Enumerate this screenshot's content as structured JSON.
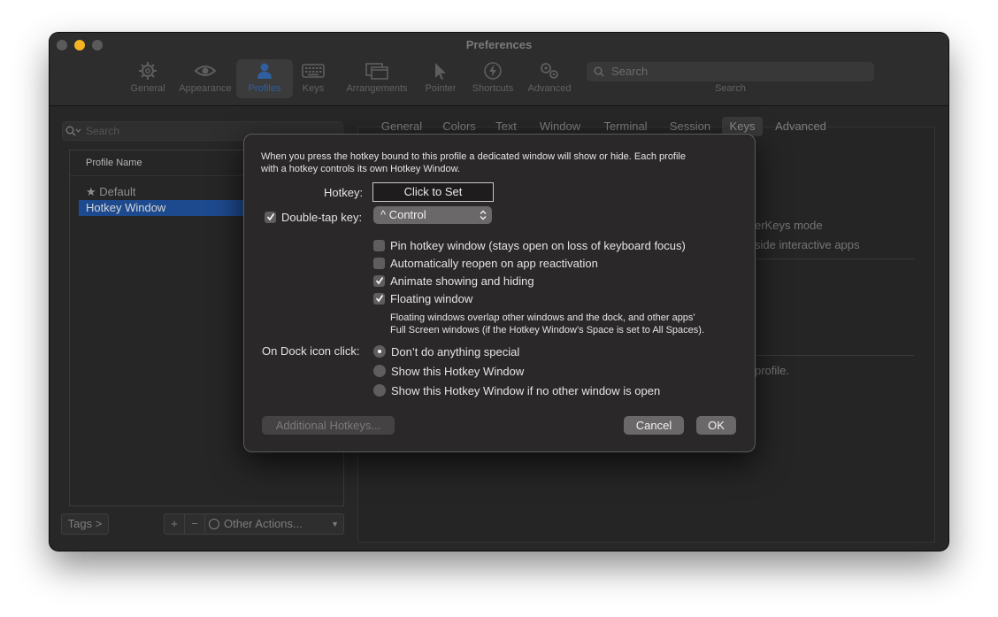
{
  "window": {
    "title": "Preferences"
  },
  "toolbar": {
    "items": [
      {
        "label": "General",
        "icon": "gear-icon"
      },
      {
        "label": "Appearance",
        "icon": "eye-icon"
      },
      {
        "label": "Profiles",
        "icon": "person-icon"
      },
      {
        "label": "Keys",
        "icon": "keyboard-icon"
      },
      {
        "label": "Arrangements",
        "icon": "windows-icon"
      },
      {
        "label": "Pointer",
        "icon": "cursor-icon"
      },
      {
        "label": "Shortcuts",
        "icon": "bolt-icon"
      },
      {
        "label": "Advanced",
        "icon": "gears-icon"
      }
    ],
    "search_placeholder": "Search",
    "search_label": "Search"
  },
  "sidebar": {
    "search_placeholder": "Search",
    "column_header": "Profile Name",
    "profiles": [
      {
        "label": "★ Default"
      },
      {
        "label": "Hotkey Window"
      }
    ],
    "tags_button": "Tags >",
    "add_button": "+",
    "remove_button": "−",
    "other_actions": "Other Actions..."
  },
  "tabs": [
    "General",
    "Colors",
    "Text",
    "Window",
    "Terminal",
    "Session",
    "Keys",
    "Advanced"
  ],
  "background_text": {
    "line1": "erKeys mode",
    "line2": "side interactive apps",
    "line3": "profile."
  },
  "dialog": {
    "description_line1": "When you press the hotkey bound to this profile a dedicated window will show or hide. Each profile",
    "description_line2": "with a hotkey controls its own Hotkey Window.",
    "hotkey_label": "Hotkey:",
    "hotkey_button": "Click to Set",
    "double_tap_label": "Double-tap key:",
    "double_tap_value": "^ Control",
    "options": [
      {
        "label": "Pin hotkey window (stays open on loss of keyboard focus)",
        "checked": false
      },
      {
        "label": "Automatically reopen on app reactivation",
        "checked": false
      },
      {
        "label": "Animate showing and hiding",
        "checked": true
      },
      {
        "label": "Floating window",
        "checked": true
      }
    ],
    "floating_note_line1": "Floating windows overlap other windows and the dock, and other apps’",
    "floating_note_line2": "Full Screen windows (if the Hotkey Window’s Space is set to All Spaces).",
    "dock_label": "On Dock icon click:",
    "dock_options": [
      {
        "label": "Don’t do anything special",
        "selected": true
      },
      {
        "label": "Show this Hotkey Window",
        "selected": false
      },
      {
        "label": "Show this Hotkey Window if no other window is open",
        "selected": false
      }
    ],
    "additional_hotkeys": "Additional Hotkeys...",
    "cancel": "Cancel",
    "ok": "OK"
  }
}
